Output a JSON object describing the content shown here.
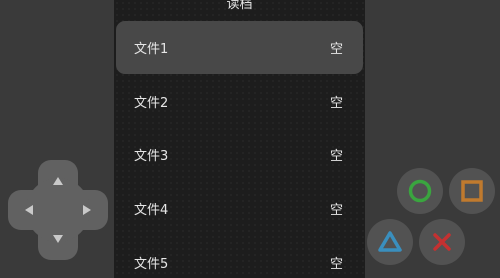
{
  "panel": {
    "title": "读档",
    "slots": [
      {
        "label": "文件1",
        "status": "空"
      },
      {
        "label": "文件2",
        "status": "空"
      },
      {
        "label": "文件3",
        "status": "空"
      },
      {
        "label": "文件4",
        "status": "空"
      },
      {
        "label": "文件5",
        "status": "空"
      }
    ]
  },
  "controls": {
    "dpad_icons": [
      "arrow-up-icon",
      "arrow-down-icon",
      "arrow-left-icon",
      "arrow-right-icon"
    ],
    "face_buttons": [
      {
        "name": "circle-button",
        "color": "#3aa53f"
      },
      {
        "name": "square-button",
        "color": "#c07a2e"
      },
      {
        "name": "triangle-button",
        "color": "#3a8fbe"
      },
      {
        "name": "cross-button",
        "color": "#c43131"
      }
    ]
  },
  "colors": {
    "background": "#3a3a3a",
    "panel": "#1d1d1d",
    "selected_row": "#484848",
    "button": "#525252",
    "dpad": "#616161"
  }
}
